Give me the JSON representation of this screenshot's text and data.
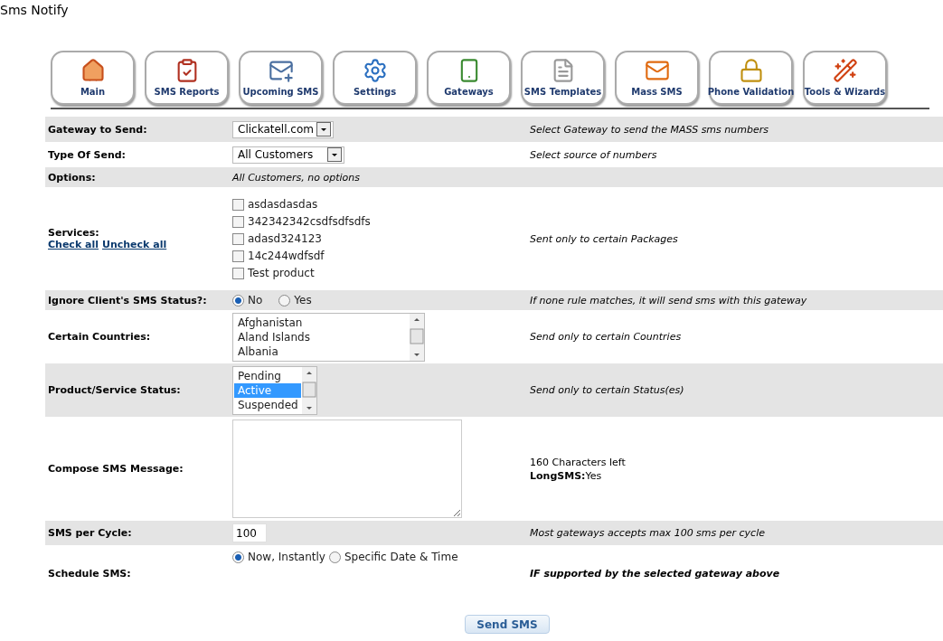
{
  "page_title": "Sms Notify",
  "tabs": [
    {
      "label": "Main",
      "selected": false
    },
    {
      "label": "SMS Reports",
      "selected": false
    },
    {
      "label": "Upcoming SMS",
      "selected": false
    },
    {
      "label": "Settings",
      "selected": false
    },
    {
      "label": "Gateways",
      "selected": false
    },
    {
      "label": "SMS Templates",
      "selected": false
    },
    {
      "label": "Mass SMS",
      "selected": false
    },
    {
      "label": "Phone Validation",
      "selected": false
    },
    {
      "label": "Tools & Wizards",
      "selected": false
    }
  ],
  "rows": [
    {
      "kind": "select",
      "label": "Gateway to Send:",
      "value": "Clickatell.com",
      "wide": false,
      "hint": "Select Gateway to send the MASS sms numbers"
    },
    {
      "kind": "select",
      "label": "Type Of Send:",
      "value": "All Customers",
      "wide": true,
      "hint": "Select source of numbers"
    },
    {
      "kind": "note",
      "label": "Options:",
      "value": "All Customers, no options"
    },
    {
      "kind": "checkboxes",
      "label": "Services:",
      "links": [
        "Check all",
        "Uncheck all"
      ],
      "items": [
        {
          "label": "asdasdasdas",
          "checked": false
        },
        {
          "label": "342342342csdfsdfsdfs",
          "checked": false
        },
        {
          "label": "adasd324123",
          "checked": false
        },
        {
          "label": "14c244wdfsdf",
          "checked": false
        },
        {
          "label": "Test product",
          "checked": false
        }
      ],
      "hint": "Sent only to certain Packages"
    },
    {
      "kind": "radios",
      "label": "Ignore Client's SMS Status?:",
      "items": [
        {
          "label": "No",
          "selected": true
        },
        {
          "label": "Yes",
          "selected": false
        }
      ],
      "hint": "If none rule matches, it will send sms with this gateway"
    },
    {
      "kind": "listbox",
      "label": "Certain Countries:",
      "wide": true,
      "items": [
        {
          "label": "Afghanistan",
          "selected": false
        },
        {
          "label": "Aland Islands",
          "selected": false
        },
        {
          "label": "Albania",
          "selected": false
        }
      ],
      "hint": "Send only to certain Countries"
    },
    {
      "kind": "listbox",
      "label": "Product/Service Status:",
      "wide": false,
      "items": [
        {
          "label": "Pending",
          "selected": false
        },
        {
          "label": "Active",
          "selected": true
        },
        {
          "label": "Suspended",
          "selected": false
        }
      ],
      "hint": "Send only to certain Status(es)"
    },
    {
      "kind": "textarea",
      "label": "Compose SMS Message:",
      "info": [
        "160 Characters left",
        "**LongSMS:**Yes"
      ]
    },
    {
      "kind": "input",
      "label": "SMS per Cycle:",
      "value": "100",
      "hint": "Most gateways accepts max 100 sms per cycle"
    },
    {
      "kind": "radios",
      "label": "Schedule SMS:",
      "items": [
        {
          "label": "Now, Instantly",
          "selected": true
        },
        {
          "label": "Specific Date & Time",
          "selected": false
        }
      ],
      "hint": "IF supported by the selected gateway above",
      "hint_bold": true
    }
  ],
  "submit": "Send SMS"
}
